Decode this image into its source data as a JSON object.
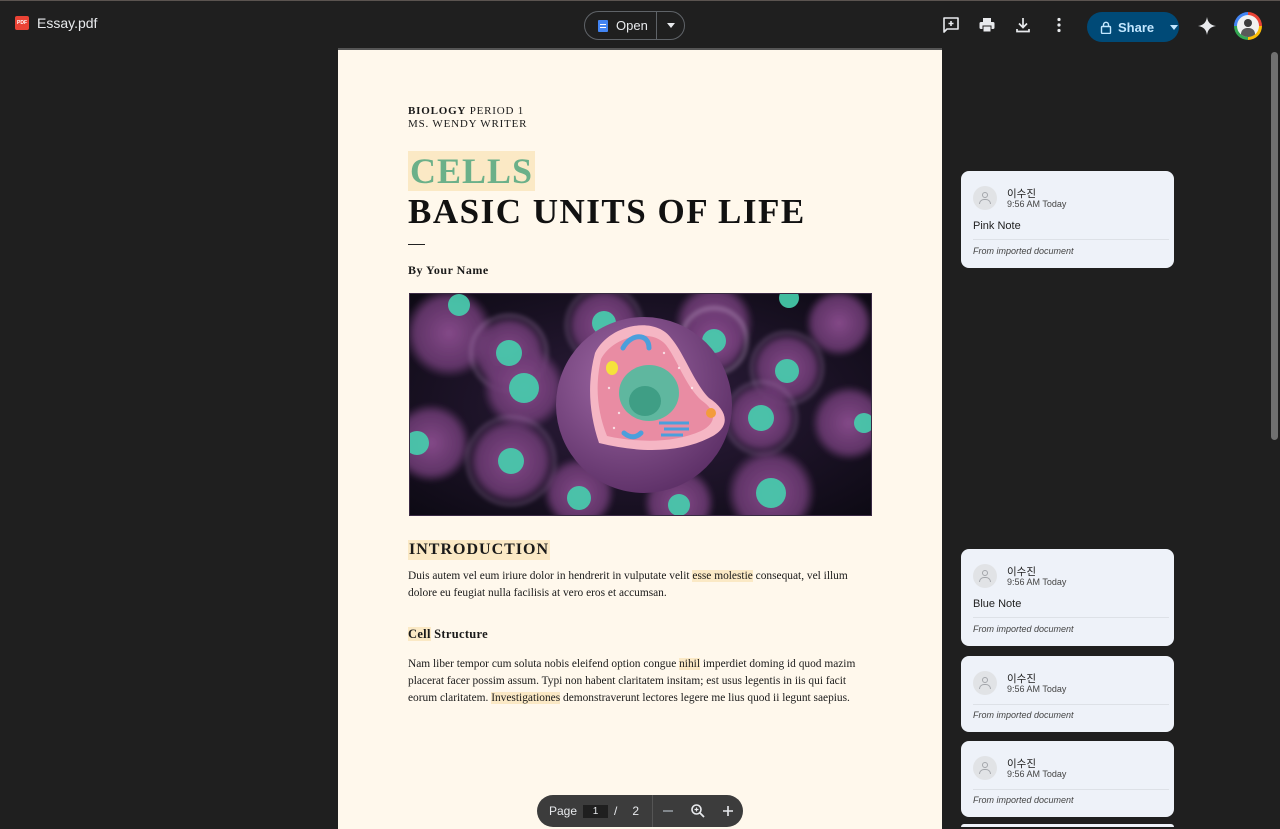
{
  "header": {
    "file_name": "Essay.pdf",
    "open_label": "Open",
    "share_label": "Share"
  },
  "document": {
    "kicker_bold": "BIOLOGY",
    "kicker_rest": " PERIOD 1",
    "teacher": "MS. WENDY WRITER",
    "title_highlight": "CELLS",
    "title_main": "BASIC UNITS OF LIFE",
    "byline": "By Your Name",
    "intro_heading": "INTRODUCTION",
    "intro_p1_a": "Duis autem vel eum iriure dolor in hendrerit in vulputate velit ",
    "intro_p1_hl": "esse molestie",
    "intro_p1_b": " consequat, vel illum dolore eu feugiat nulla facilisis at vero eros et accumsan.",
    "cell_heading_hl": "Cell",
    "cell_heading_rest": " Structure",
    "cell_p_a": "Nam liber tempor cum soluta nobis eleifend option congue ",
    "cell_p_hl1": "nihil",
    "cell_p_b": " imperdiet doming id quod mazim placerat facer possim assum. Typi non habent claritatem insitam; est usus legentis in iis qui facit eorum claritatem. ",
    "cell_p_hl2": "Investigationes",
    "cell_p_c": " demonstraverunt lectores legere me lius quod ii legunt saepius."
  },
  "pager": {
    "label": "Page",
    "current": "1",
    "separator": "/",
    "total": "2"
  },
  "comments": [
    {
      "author": "이수진",
      "time": "9:56 AM Today",
      "body": "Pink Note",
      "footer": "From imported document"
    },
    {
      "author": "이수진",
      "time": "9:56 AM Today",
      "body": "Blue Note",
      "footer": "From imported document"
    },
    {
      "author": "이수진",
      "time": "9:56 AM Today",
      "body": "",
      "footer": "From imported document"
    },
    {
      "author": "이수진",
      "time": "9:56 AM Today",
      "body": "",
      "footer": "From imported document"
    }
  ],
  "colors": {
    "page_bg": "#fff8ec",
    "highlight": "#fbe9c5",
    "cells_green": "#6bb089",
    "share_bg": "#004a77"
  }
}
